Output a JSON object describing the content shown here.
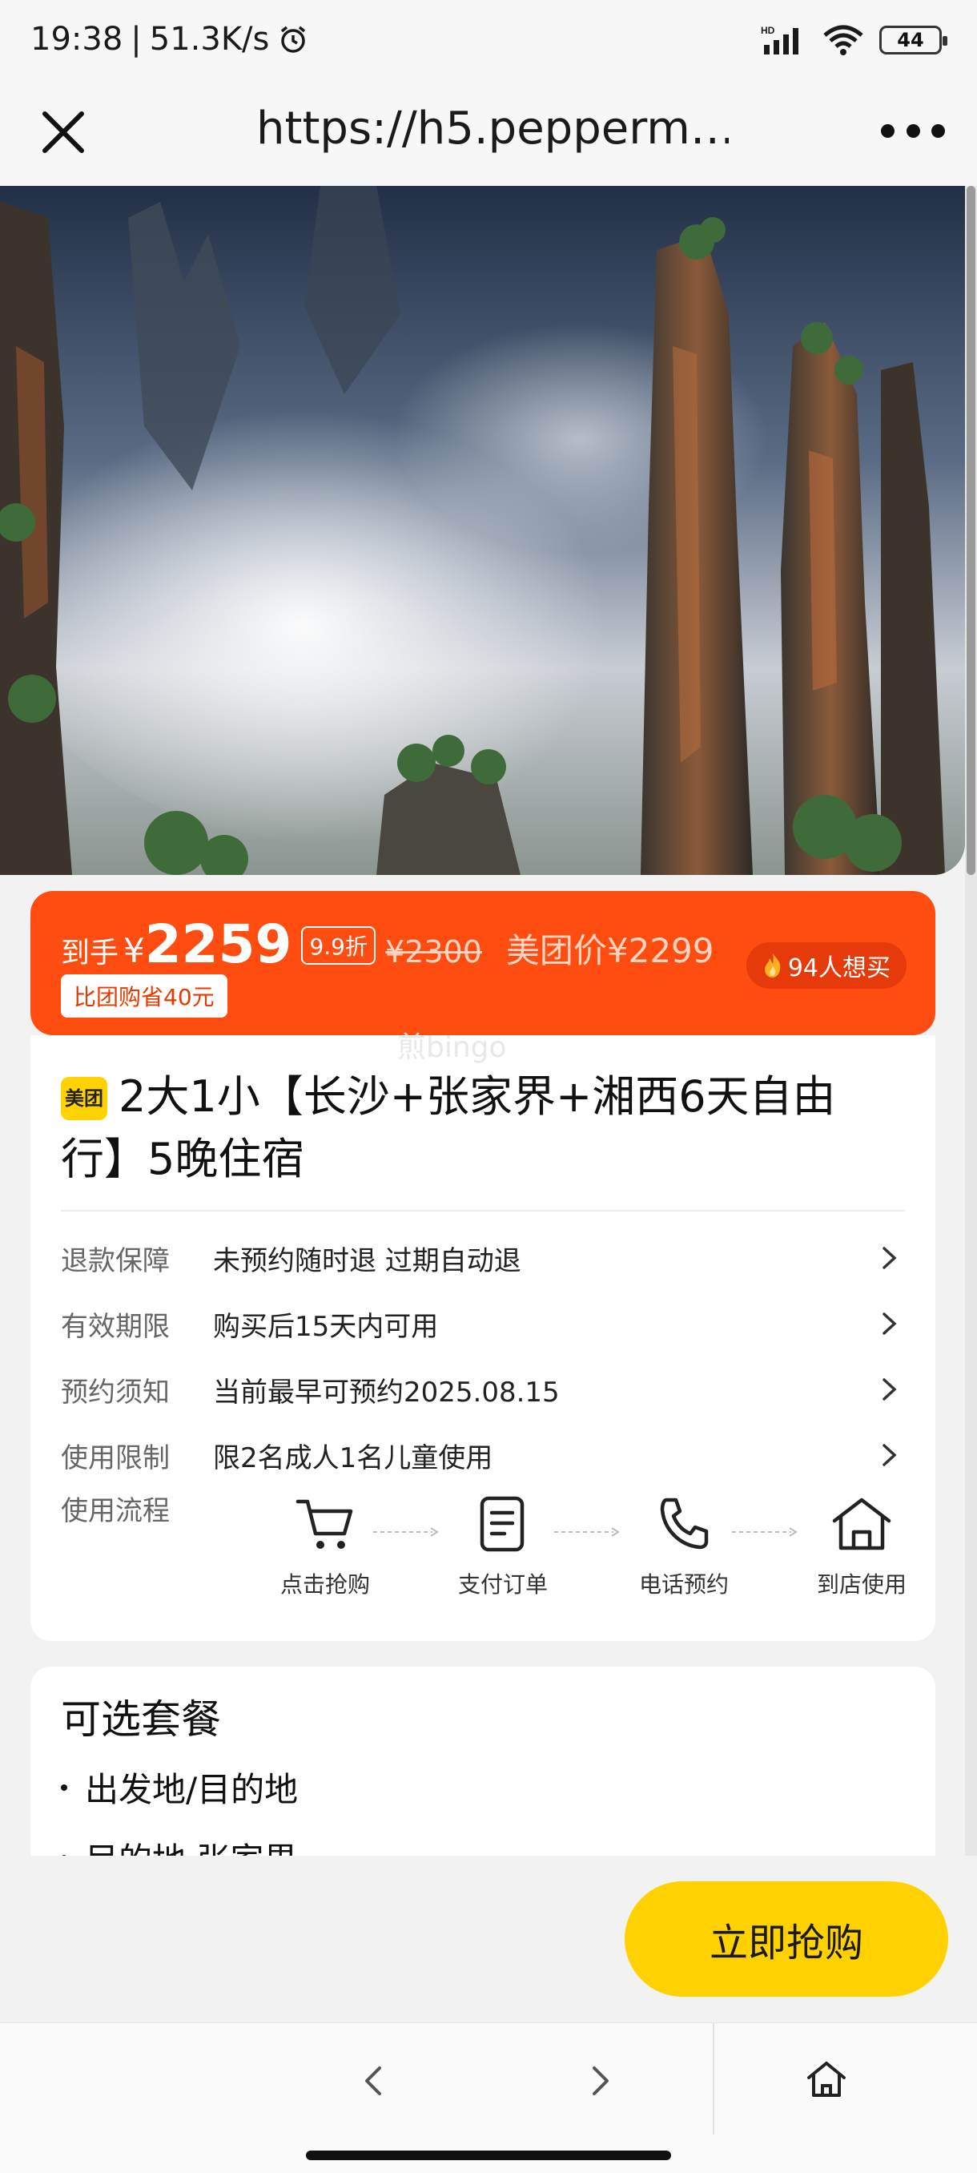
{
  "status_bar": {
    "time": "19:38",
    "separator": "|",
    "speed": "51.3K/s",
    "network_label": "HD",
    "battery": "44"
  },
  "title_bar": {
    "url": "https://h5.pepperm…"
  },
  "price_banner": {
    "label": "到手",
    "currency": "¥",
    "price": "2259",
    "discount": "9.9折",
    "original_price": "¥2300",
    "meituan_price": "美团价¥2299",
    "save_text": "比团购省40元",
    "want_text": "94人想买"
  },
  "watermark": "煎bingo",
  "product": {
    "logo_text": "美团",
    "title": "2大1小【长沙+张家界+湘西6天自由行】5晚住宿"
  },
  "info_rows": [
    {
      "label": "退款保障",
      "value": "未预约随时退 过期自动退"
    },
    {
      "label": "有效期限",
      "value": "购买后15天内可用"
    },
    {
      "label": "预约须知",
      "value": "当前最早可预约2025.08.15"
    },
    {
      "label": "使用限制",
      "value": "限2名成人1名儿童使用"
    }
  ],
  "flow": {
    "label": "使用流程",
    "steps": [
      {
        "label": "点击抢购",
        "icon": "cart-icon"
      },
      {
        "label": "支付订单",
        "icon": "document-icon"
      },
      {
        "label": "电话预约",
        "icon": "phone-icon"
      },
      {
        "label": "到店使用",
        "icon": "home-icon"
      }
    ]
  },
  "options": {
    "title": "可选套餐",
    "items": [
      "出发地/目的地",
      "目的地 张家界"
    ]
  },
  "cta": {
    "buy_label": "立即抢购"
  },
  "colors": {
    "accent_orange": "#ff4d11",
    "cta_yellow": "#ffd100",
    "meituan_yellow": "#ffd200"
  }
}
